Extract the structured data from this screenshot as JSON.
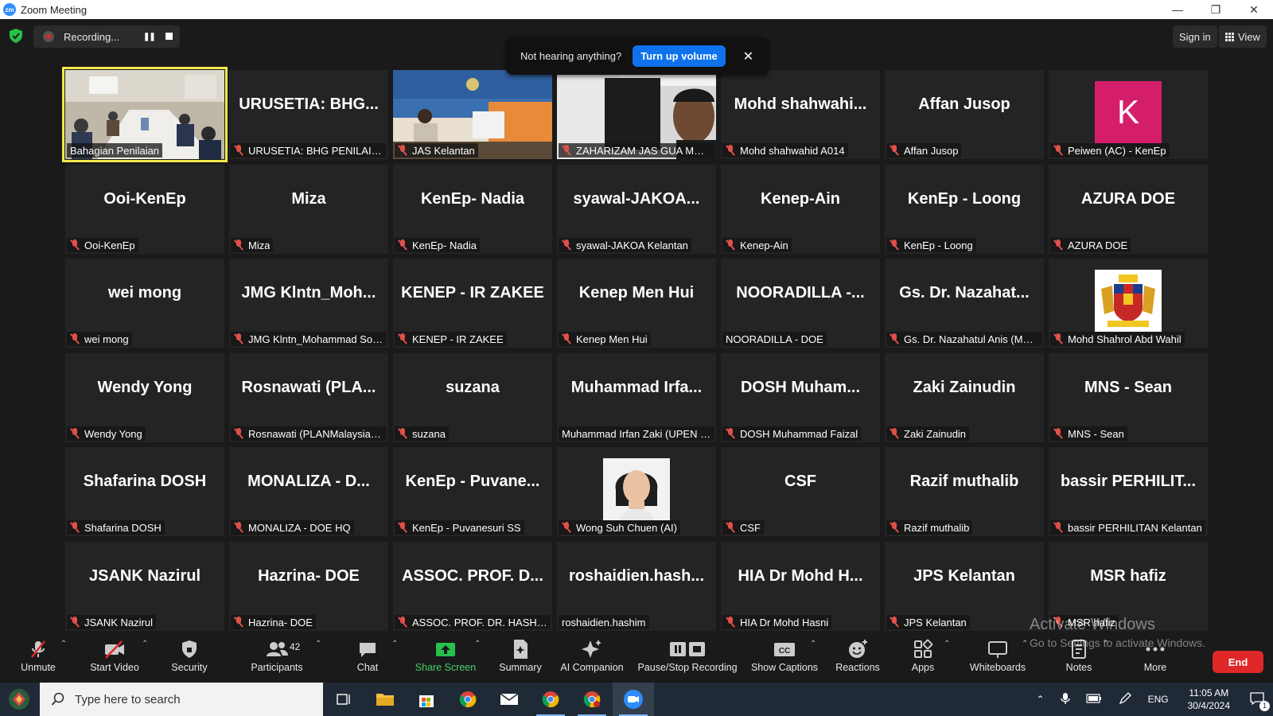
{
  "window": {
    "title": "Zoom Meeting",
    "app_icon": "zm",
    "controls": [
      "minimize",
      "restore",
      "close"
    ]
  },
  "topbar": {
    "recording_label": "Recording...",
    "sign_in": "Sign in",
    "view": "View"
  },
  "toast": {
    "message": "Not hearing anything?",
    "action": "Turn up volume"
  },
  "tiles": [
    {
      "label": "Bahagian Penilaian",
      "big": "",
      "kind": "video-room",
      "muted": false,
      "active": true
    },
    {
      "label": "URUSETIA: BHG PENILAIAN",
      "big": "URUSETIA: BHG...",
      "kind": "name",
      "muted": true
    },
    {
      "label": "JAS Kelantan",
      "big": "",
      "kind": "video-jas",
      "muted": true
    },
    {
      "label": "ZAHARIZAM JAS GUA MUS...",
      "big": "",
      "kind": "video-man",
      "muted": true
    },
    {
      "label": "Mohd shahwahid A014",
      "big": "Mohd shahwahi...",
      "kind": "name",
      "muted": true
    },
    {
      "label": "Affan Jusop",
      "big": "Affan Jusop",
      "kind": "name",
      "muted": true
    },
    {
      "label": "Peiwen (AC) - KenEp",
      "big": "K",
      "kind": "avatar-k",
      "muted": true
    },
    {
      "label": "Ooi-KenEp",
      "big": "Ooi-KenEp",
      "kind": "name",
      "muted": true
    },
    {
      "label": "Miza",
      "big": "Miza",
      "kind": "name",
      "muted": true
    },
    {
      "label": "KenEp- Nadia",
      "big": "KenEp- Nadia",
      "kind": "name",
      "muted": true
    },
    {
      "label": "syawal-JAKOA Kelantan",
      "big": "syawal-JAKOA...",
      "kind": "name",
      "muted": true
    },
    {
      "label": "Kenep-Ain",
      "big": "Kenep-Ain",
      "kind": "name",
      "muted": true
    },
    {
      "label": "KenEp - Loong",
      "big": "KenEp - Loong",
      "kind": "name",
      "muted": true
    },
    {
      "label": "AZURA DOE",
      "big": "AZURA DOE",
      "kind": "name",
      "muted": true
    },
    {
      "label": "wei mong",
      "big": "wei mong",
      "kind": "name",
      "muted": true
    },
    {
      "label": "JMG Klntn_Mohammad Sobri",
      "big": "JMG Klntn_Moh...",
      "kind": "name",
      "muted": true
    },
    {
      "label": "KENEP - IR ZAKEE",
      "big": "KENEP - IR ZAKEE",
      "kind": "name",
      "muted": true
    },
    {
      "label": "Kenep Men Hui",
      "big": "Kenep Men Hui",
      "kind": "name",
      "muted": true
    },
    {
      "label": "NOORADILLA - DOE",
      "big": "NOORADILLA -...",
      "kind": "name",
      "muted": false
    },
    {
      "label": "Gs. Dr. Nazahatul Anis (MNS...",
      "big": "Gs. Dr. Nazahat...",
      "kind": "name",
      "muted": true
    },
    {
      "label": "Mohd Shahrol Abd Wahil",
      "big": "",
      "kind": "avatar-crest",
      "muted": true
    },
    {
      "label": "Wendy Yong",
      "big": "Wendy Yong",
      "kind": "name",
      "muted": true
    },
    {
      "label": "Rosnawati (PLANMalaysia@...",
      "big": "Rosnawati (PLA...",
      "kind": "name",
      "muted": true
    },
    {
      "label": "suzana",
      "big": "suzana",
      "kind": "name",
      "muted": true
    },
    {
      "label": "Muhammad Irfan Zaki (UPEN K...",
      "big": "Muhammad Irfa...",
      "kind": "name",
      "muted": false
    },
    {
      "label": "DOSH Muhammad Faizal",
      "big": "DOSH Muham...",
      "kind": "name",
      "muted": true
    },
    {
      "label": "Zaki Zainudin",
      "big": "Zaki Zainudin",
      "kind": "name",
      "muted": true
    },
    {
      "label": "MNS - Sean",
      "big": "MNS - Sean",
      "kind": "name",
      "muted": true
    },
    {
      "label": "Shafarina DOSH",
      "big": "Shafarina DOSH",
      "kind": "name",
      "muted": true
    },
    {
      "label": "MONALIZA - DOE HQ",
      "big": "MONALIZA - D...",
      "kind": "name",
      "muted": true
    },
    {
      "label": "KenEp - Puvanesuri SS",
      "big": "KenEp - Puvane...",
      "kind": "name",
      "muted": true
    },
    {
      "label": "Wong Suh Chuen (AI)",
      "big": "",
      "kind": "avatar-woman",
      "muted": true
    },
    {
      "label": "CSF",
      "big": "CSF",
      "kind": "name",
      "muted": true
    },
    {
      "label": "Razif muthalib",
      "big": "Razif muthalib",
      "kind": "name",
      "muted": true
    },
    {
      "label": "bassir PERHILITAN Kelantan",
      "big": "bassir PERHILIT...",
      "kind": "name",
      "muted": true
    },
    {
      "label": "JSANK Nazirul",
      "big": "JSANK Nazirul",
      "kind": "name",
      "muted": true
    },
    {
      "label": "Hazrina- DOE",
      "big": "Hazrina- DOE",
      "kind": "name",
      "muted": true
    },
    {
      "label": "ASSOC. PROF. DR. HASHIM ...",
      "big": "ASSOC. PROF. D...",
      "kind": "name",
      "muted": true
    },
    {
      "label": "roshaidien.hashim",
      "big": "roshaidien.hash...",
      "kind": "name",
      "muted": false
    },
    {
      "label": "HIA Dr Mohd Hasni",
      "big": "HIA Dr Mohd H...",
      "kind": "name",
      "muted": true
    },
    {
      "label": "JPS Kelantan",
      "big": "JPS Kelantan",
      "kind": "name",
      "muted": true
    },
    {
      "label": "MSR hafiz",
      "big": "MSR hafiz",
      "kind": "name",
      "muted": true
    }
  ],
  "toolbar": {
    "unmute": "Unmute",
    "start_video": "Start Video",
    "security": "Security",
    "participants": "Participants",
    "participant_count": "42",
    "chat": "Chat",
    "share_screen": "Share Screen",
    "summary": "Summary",
    "ai_companion": "AI Companion",
    "pause_stop_recording": "Pause/Stop Recording",
    "show_captions": "Show Captions",
    "reactions": "Reactions",
    "apps": "Apps",
    "whiteboards": "Whiteboards",
    "notes": "Notes",
    "more": "More",
    "end": "End"
  },
  "watermark": {
    "line1": "Activate Windows",
    "line2": "Go to Settings to activate Windows."
  },
  "taskbar": {
    "search_placeholder": "Type here to search",
    "language": "ENG",
    "time": "11:05 AM",
    "date": "30/4/2024",
    "notification_count": "1"
  },
  "colors": {
    "zoom_blue": "#0e72ed",
    "end_red": "#e02828",
    "active_speaker": "#f5e84a",
    "share_green": "#4ad06b",
    "muted_red": "#e0504a"
  }
}
